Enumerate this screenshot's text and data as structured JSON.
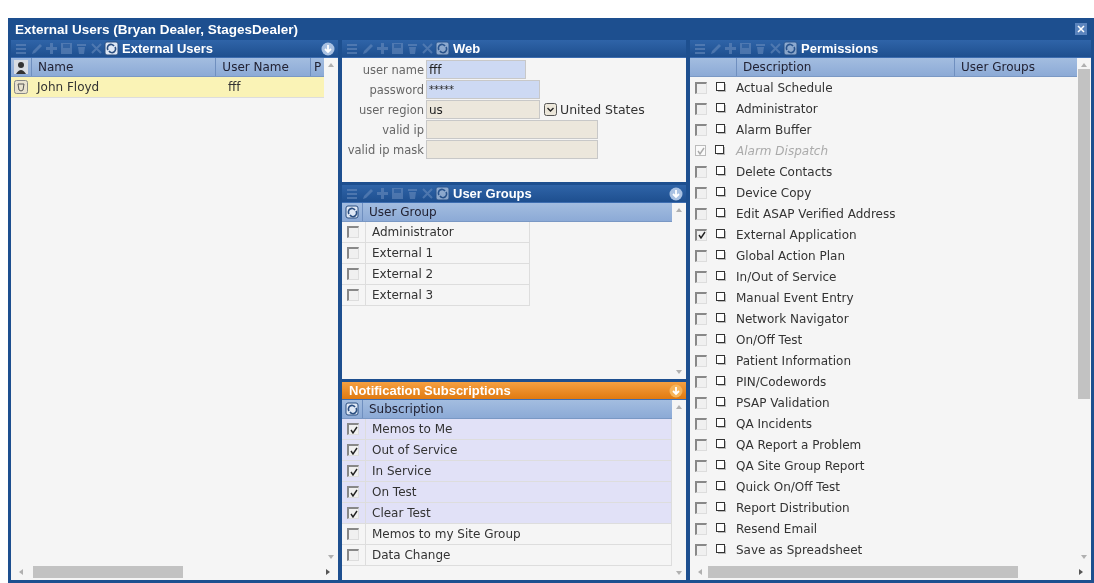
{
  "window": {
    "title": "External Users (Bryan Dealer, StagesDealer)"
  },
  "external_users": {
    "title": "External Users",
    "refresh_enabled": true,
    "collapsible": true,
    "columns": [
      "Name",
      "User Name",
      "P"
    ],
    "rows": [
      {
        "name": "John Floyd",
        "user_name": "fff",
        "selected": true
      }
    ]
  },
  "web": {
    "title": "Web",
    "fields": [
      {
        "label": "user name",
        "value": "fff",
        "kind": "text"
      },
      {
        "label": "password",
        "value": "*****",
        "kind": "password"
      },
      {
        "label": "user region",
        "value": "us",
        "kind": "select",
        "option": "United States"
      },
      {
        "label": "valid ip",
        "kind": "readonly"
      },
      {
        "label": "valid ip mask",
        "kind": "readonly"
      }
    ]
  },
  "user_groups": {
    "title": "User Groups",
    "collapsible": true,
    "column": "User Group",
    "rows": [
      {
        "label": "Administrator",
        "checked": false
      },
      {
        "label": "External 1",
        "checked": false
      },
      {
        "label": "External 2",
        "checked": false
      },
      {
        "label": "External 3",
        "checked": false
      }
    ]
  },
  "notification_subscriptions": {
    "title": "Notification Subscriptions",
    "active": true,
    "collapsible": true,
    "column": "Subscription",
    "rows": [
      {
        "label": "Memos to Me",
        "checked": true
      },
      {
        "label": "Out of Service",
        "checked": true
      },
      {
        "label": "In Service",
        "checked": true
      },
      {
        "label": "On Test",
        "checked": true
      },
      {
        "label": "Clear Test",
        "checked": true
      },
      {
        "label": "Memos to my Site Group",
        "checked": false
      },
      {
        "label": "Data Change",
        "checked": false
      }
    ]
  },
  "permissions": {
    "title": "Permissions",
    "columns": [
      "Description",
      "User Groups"
    ],
    "rows": [
      {
        "label": "Actual Schedule",
        "checked": false,
        "disabled": false
      },
      {
        "label": "Administrator",
        "checked": false,
        "disabled": false
      },
      {
        "label": "Alarm Buffer",
        "checked": false,
        "disabled": false
      },
      {
        "label": "Alarm Dispatch",
        "checked": true,
        "disabled": true
      },
      {
        "label": "Delete Contacts",
        "checked": false,
        "disabled": false
      },
      {
        "label": "Device Copy",
        "checked": false,
        "disabled": false
      },
      {
        "label": "Edit ASAP Verified Address",
        "checked": false,
        "disabled": false
      },
      {
        "label": "External Application",
        "checked": true,
        "disabled": false
      },
      {
        "label": "Global Action Plan",
        "checked": false,
        "disabled": false
      },
      {
        "label": "In/Out of Service",
        "checked": false,
        "disabled": false
      },
      {
        "label": "Manual Event Entry",
        "checked": false,
        "disabled": false
      },
      {
        "label": "Network Navigator",
        "checked": false,
        "disabled": false
      },
      {
        "label": "On/Off Test",
        "checked": false,
        "disabled": false
      },
      {
        "label": "Patient Information",
        "checked": false,
        "disabled": false
      },
      {
        "label": "PIN/Codewords",
        "checked": false,
        "disabled": false
      },
      {
        "label": "PSAP Validation",
        "checked": false,
        "disabled": false
      },
      {
        "label": "QA Incidents",
        "checked": false,
        "disabled": false
      },
      {
        "label": "QA Report a Problem",
        "checked": false,
        "disabled": false
      },
      {
        "label": "QA Site Group Report",
        "checked": false,
        "disabled": false
      },
      {
        "label": "Quick On/Off Test",
        "checked": false,
        "disabled": false
      },
      {
        "label": "Report Distribution",
        "checked": false,
        "disabled": false
      },
      {
        "label": "Resend Email",
        "checked": false,
        "disabled": false
      },
      {
        "label": "Save as Spreadsheet",
        "checked": false,
        "disabled": false
      }
    ]
  }
}
